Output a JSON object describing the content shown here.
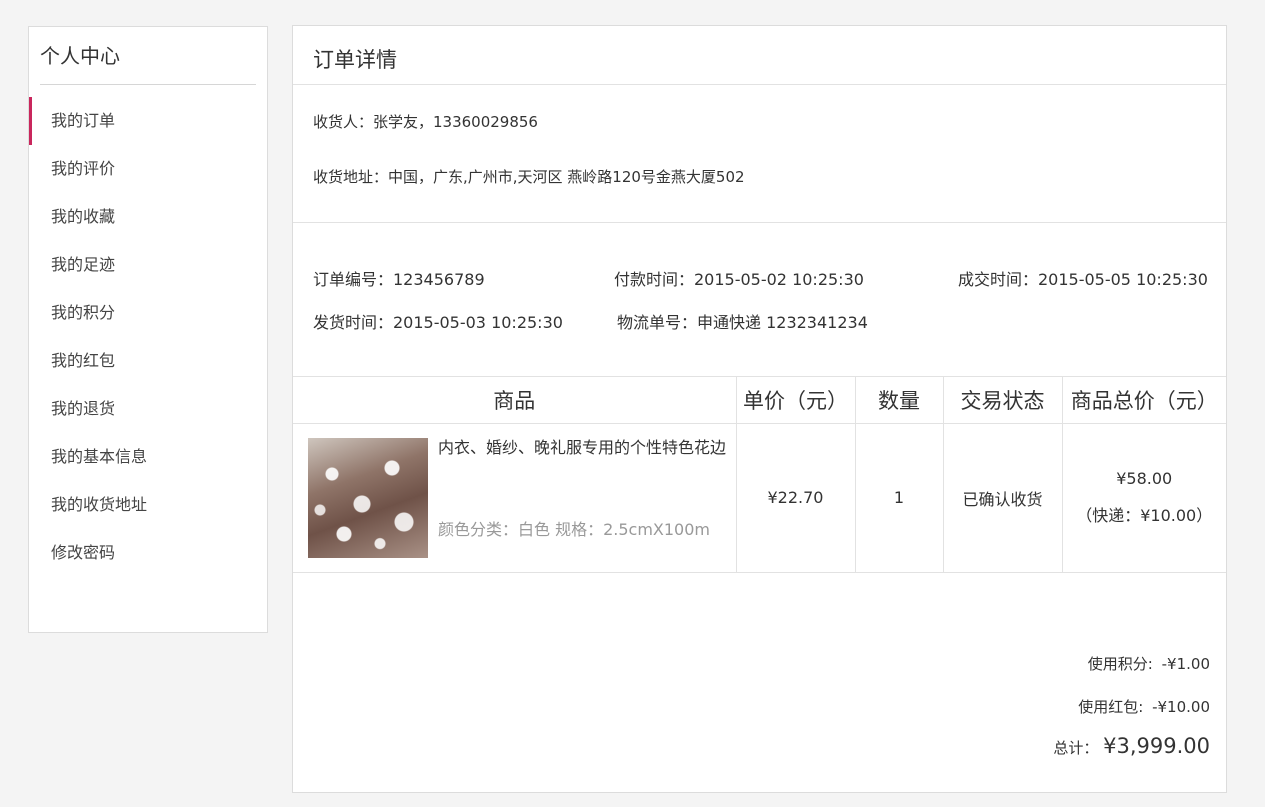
{
  "sidebar": {
    "title": "个人中心",
    "items": [
      {
        "label": "我的订单"
      },
      {
        "label": "我的评价"
      },
      {
        "label": "我的收藏"
      },
      {
        "label": "我的足迹"
      },
      {
        "label": "我的积分"
      },
      {
        "label": "我的红包"
      },
      {
        "label": "我的退货"
      },
      {
        "label": "我的基本信息"
      },
      {
        "label": "我的收货地址"
      },
      {
        "label": "修改密码"
      }
    ],
    "active_index": 0,
    "accent_color": "#c9265c"
  },
  "main": {
    "title": "订单详情",
    "receiver": "收货人：张学友，13360029856",
    "address": "收货地址：中国，广东,广州市,天河区 燕岭路120号金燕大厦502",
    "order_no": "订单编号：123456789",
    "pay_time": "付款时间：2015-05-02  10:25:30",
    "deal_time": "成交时间：2015-05-05  10:25:30",
    "ship_time": "发货时间：2015-05-03  10:25:30",
    "logistics_no": "物流单号：申通快递    1232341234"
  },
  "table": {
    "headers": [
      "商品",
      "单价（元）",
      "数量",
      "交易状态",
      "商品总价（元）"
    ],
    "row": {
      "name": "内衣、婚纱、晚礼服专用的个性特色花边",
      "spec": "颜色分类：白色   规格：2.5cmX100m",
      "unit_price": "¥22.70",
      "quantity": "1",
      "status": "已确认收货",
      "total": "¥58.00",
      "shipping": "（快递：¥10.00）"
    }
  },
  "summary": {
    "points_label": "使用积分:",
    "points_value": "-¥1.00",
    "coupon_label": "使用红包:",
    "coupon_value": "-¥10.00",
    "total_label": "总计：",
    "total_value": "¥3,999.00"
  }
}
